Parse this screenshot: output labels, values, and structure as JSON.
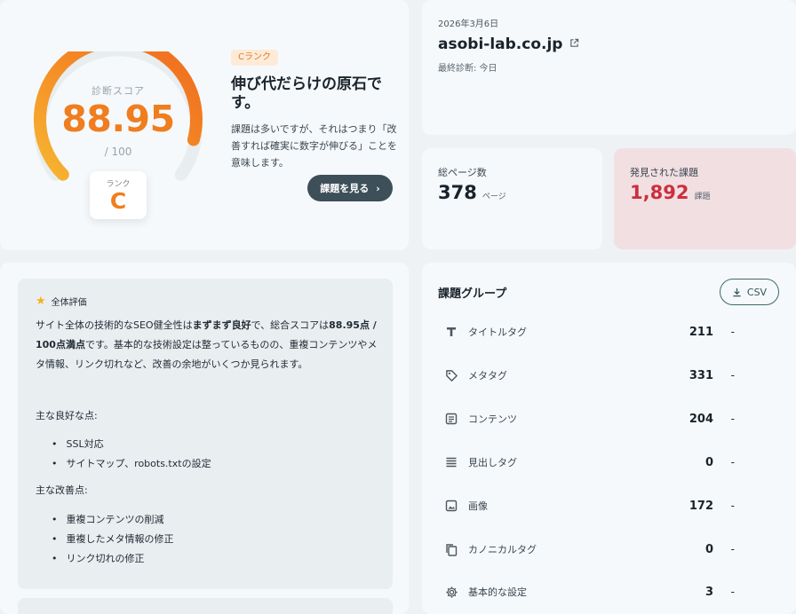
{
  "score_card": {
    "gauge_label": "診断スコア",
    "score": "88.95",
    "max": "/ 100",
    "rank_label": "ランク",
    "rank_letter": "C",
    "rank_badge": "Cランク",
    "headline": "伸び代だらけの原石です。",
    "description": "課題は多いですが、それはつまり「改善すれば確実に数字が伸びる」ことを意味します。",
    "button_label": "課題を見る",
    "button_chevron": "›",
    "score_fraction": 0.8895,
    "accent_color": "#f07d1e"
  },
  "site_card": {
    "date": "2026年3月6日",
    "domain": "asobi-lab.co.jp",
    "external_icon": "external-link-icon",
    "last_diag": "最終診断: 今日"
  },
  "pages_card": {
    "label": "総ページ数",
    "value": "378",
    "unit": "ページ"
  },
  "found_card": {
    "label": "発見された課題",
    "value": "1,892",
    "unit": "課題",
    "color": "#cc2f3d"
  },
  "evaluation": {
    "title": "全体評価",
    "body_1": "サイト全体の技術的なSEO健全性は",
    "body_bold_1": "まずまず良好",
    "body_2": "で、総合スコアは",
    "body_bold_2": "88.95点 / 100点満点",
    "body_3": "です。基本的な技術設定は整っているものの、重複コンテンツやメタ情報、リンク切れなど、改善の余地がいくつか見られます。",
    "good_head": "主な良好な点:",
    "good_points": [
      "SSL対応",
      "サイトマップ、robots.txtの設定"
    ],
    "improve_head": "主な改善点:",
    "improve_points": [
      "重複コンテンツの削減",
      "重複したメタ情報の修正",
      "リンク切れの修正"
    ]
  },
  "groups": {
    "title": "課題グループ",
    "csv_label": "CSV",
    "rows": [
      {
        "label": "タイトルタグ",
        "count": "211",
        "dash": "-",
        "icon": "title-icon"
      },
      {
        "label": "メタタグ",
        "count": "331",
        "dash": "-",
        "icon": "tag-icon"
      },
      {
        "label": "コンテンツ",
        "count": "204",
        "dash": "-",
        "icon": "document-icon"
      },
      {
        "label": "見出しタグ",
        "count": "0",
        "dash": "-",
        "icon": "headings-icon"
      },
      {
        "label": "画像",
        "count": "172",
        "dash": "-",
        "icon": "image-icon"
      },
      {
        "label": "カノニカルタグ",
        "count": "0",
        "dash": "-",
        "icon": "copy-icon"
      },
      {
        "label": "基本的な設定",
        "count": "3",
        "dash": "-",
        "icon": "gear-icon"
      }
    ]
  }
}
